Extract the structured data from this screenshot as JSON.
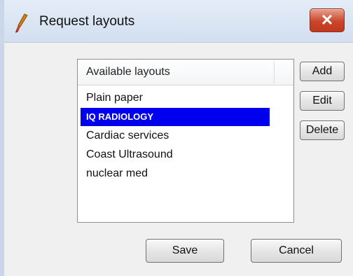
{
  "window": {
    "title": "Request layouts",
    "close_label": "✕"
  },
  "list": {
    "header": "Available layouts",
    "items": [
      "Plain paper",
      "IQ RADIOLOGY",
      "Cardiac services",
      "Coast Ultrasound",
      "nuclear med"
    ],
    "selected_item": "IQ RADIOLOGY"
  },
  "buttons": {
    "add": "Add",
    "edit": "Edit",
    "delete": "Delete",
    "save": "Save",
    "cancel": "Cancel"
  },
  "icons": {
    "app": "brush-icon",
    "close": "close-icon"
  },
  "colors": {
    "selection": "#0000ee",
    "close_button": "#c8462b",
    "titlebar": "#dae5f3"
  }
}
